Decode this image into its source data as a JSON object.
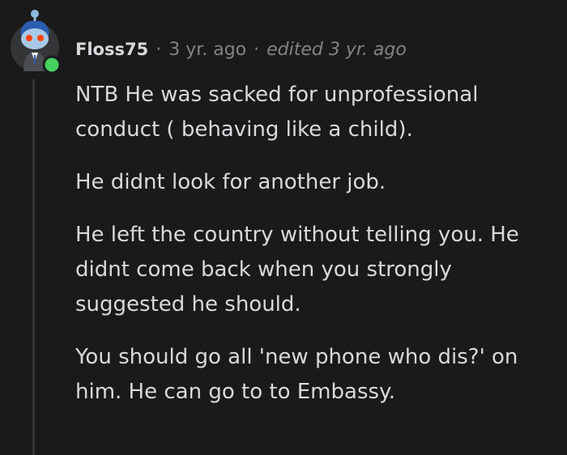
{
  "comment": {
    "author": "Floss75",
    "separator": "·",
    "time": "3 yr. ago",
    "edited": "edited 3 yr. ago",
    "paragraphs": [
      "NTB He was sacked for unprofessional conduct ( behaving like a child).",
      "He didnt look for another job.",
      "He left the country without telling you. He didnt come back when you strongly suggested he should.",
      "You should go all 'new phone who dis?' on him. He can go to to Embassy."
    ]
  },
  "avatar": {
    "icon": "snoo-avatar-icon",
    "status": "online-indicator",
    "colors": {
      "head": "#a8c8e8",
      "eyes": "#ff4500",
      "hair": "#2a5db0",
      "online": "#46d160"
    }
  },
  "colors": {
    "background": "#1a1a1b",
    "text": "#d7dadc",
    "meta": "#818384",
    "thread_line": "#343536"
  }
}
